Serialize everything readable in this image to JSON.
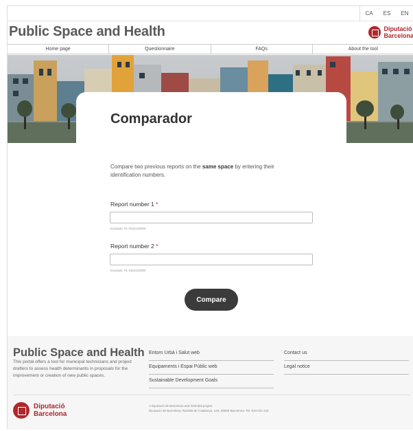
{
  "languages": [
    "CA",
    "ES",
    "EN"
  ],
  "header": {
    "title": "Public Space and Health",
    "logo_line1": "Diputació",
    "logo_line2": "Barcelona"
  },
  "nav": [
    "Home page",
    "Questionnaire",
    "FAQs",
    "About the tool"
  ],
  "main": {
    "title": "Comparador",
    "intro_before": "Compare two previous reports on the ",
    "intro_bold": "same space",
    "intro_after": " by entering their identification numbers.",
    "field1": {
      "label": "Report number 1",
      "required_mark": "*",
      "value": "",
      "help": "Example: PL-MU2100000"
    },
    "field2": {
      "label": "Report number 2",
      "required_mark": "*",
      "value": "",
      "help": "Example: PL-MU2100000"
    },
    "button": "Compare"
  },
  "footer": {
    "title": "Public Space and Health",
    "description": "This portal offers a tool for municipal technicians and project drafters to assess health determinants in proposals for the improvement or creation of new public spaces.",
    "links_col1": [
      "Entorn Urbà i Salut web",
      "Equipaments i Espai Públic web",
      "Sustainable Development Goals"
    ],
    "links_col2": [
      "Contact us",
      "Legal notice"
    ],
    "credit_line1": "A Diputació de Barcelona and ISGlobal project",
    "credit_line2": "Diputació de Barcelona, Rambla de Catalunya, 126, 08008 Barcelona. Tel. 934 022 222",
    "logo_line1": "Diputació",
    "logo_line2": "Barcelona"
  },
  "colors": {
    "brand_red": "#b0272c",
    "button": "#3b3b3b"
  }
}
